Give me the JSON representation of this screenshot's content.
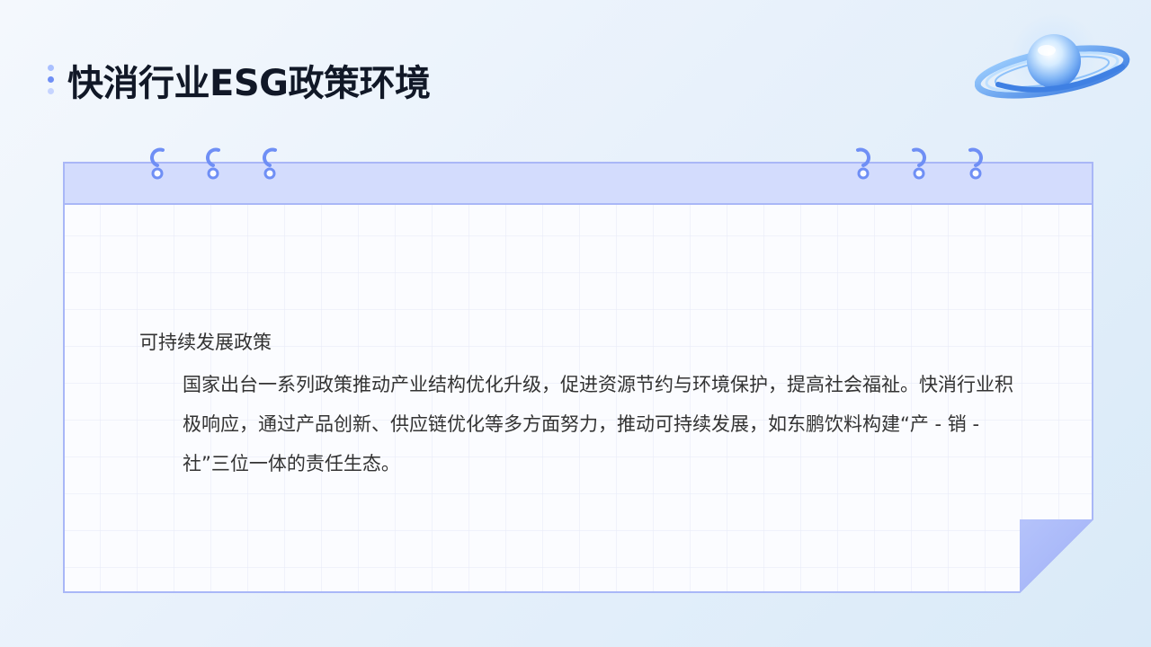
{
  "slide": {
    "title": "快消行业ESG政策环境"
  },
  "card": {
    "heading": "可持续发展政策",
    "paragraph": "国家出台一系列政策推动产业结构优化升级，促进资源节约与环境保护，提高社会福祉。快消行业积极响应，通过产品创新、供应链优化等多方面努力，推动可持续发展，如东鹏饮料构建“产 - 销 - 社”三位一体的责任生态。"
  },
  "colors": {
    "accent": "#6f8ff5",
    "card_header": "#d3dcfd",
    "card_border": "#a9b7f7",
    "grid_line": "#e6e9f7",
    "title_text": "#111827",
    "body_text": "#333333"
  },
  "icons": {
    "bullet": "dots-bullet-icon",
    "decoration": "planet-icon",
    "binder": "binder-ring-icon"
  }
}
